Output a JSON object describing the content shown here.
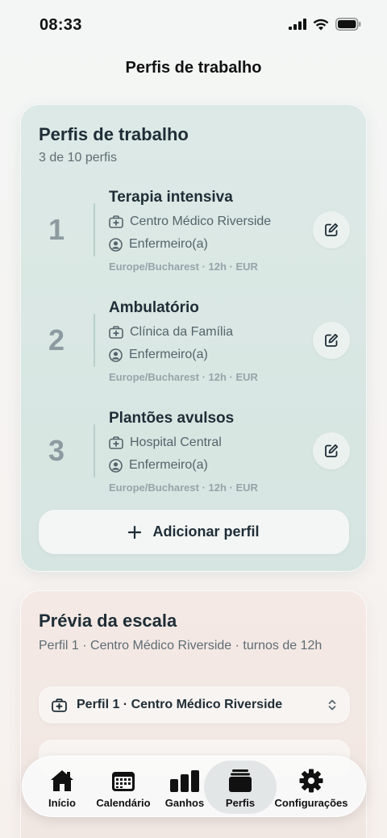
{
  "status": {
    "time": "08:33"
  },
  "nav": {
    "title": "Perfis de trabalho"
  },
  "profiles_card": {
    "title": "Perfis de trabalho",
    "subtitle": "3 de 10 perfis",
    "add_label": "Adicionar perfil",
    "items": [
      {
        "number": "1",
        "name": "Terapia intensiva",
        "facility": "Centro Médico Riverside",
        "role": "Enfermeiro(a)",
        "meta": "Europe/Bucharest · 12h · EUR"
      },
      {
        "number": "2",
        "name": "Ambulatório",
        "facility": "Clínica da Família",
        "role": "Enfermeiro(a)",
        "meta": "Europe/Bucharest · 12h · EUR"
      },
      {
        "number": "3",
        "name": "Plantões avulsos",
        "facility": "Hospital Central",
        "role": "Enfermeiro(a)",
        "meta": "Europe/Bucharest · 12h · EUR"
      }
    ]
  },
  "preview_card": {
    "title": "Prévia da escala",
    "subtitle": "Perfil 1 · Centro Médico Riverside · turnos de 12h",
    "select_value": "Perfil 1 · Centro Médico Riverside"
  },
  "tabs": [
    {
      "label": "Início",
      "icon": "home-icon"
    },
    {
      "label": "Calendário",
      "icon": "calendar-icon"
    },
    {
      "label": "Ganhos",
      "icon": "bar-chart-icon"
    },
    {
      "label": "Perfis",
      "icon": "profiles-stack-icon",
      "active": true
    },
    {
      "label": "Configurações",
      "icon": "gear-icon"
    }
  ],
  "colors": {
    "profiles_card_bg": "#d9e7e3",
    "preview_card_bg": "#f2e7e3",
    "active_tab_pill": "#e3e6e7"
  }
}
